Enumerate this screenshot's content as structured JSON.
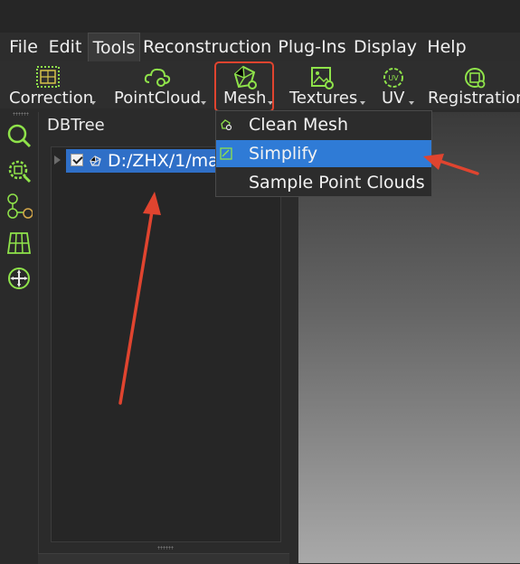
{
  "menubar": {
    "items": [
      "File",
      "Edit",
      "Tools",
      "Reconstruction",
      "Plug-Ins",
      "Display",
      "Help"
    ],
    "active": "Tools"
  },
  "toolbar": {
    "buttons": [
      {
        "label": "Correction",
        "icon": "correction-grid-icon"
      },
      {
        "label": "PointCloud",
        "icon": "pointcloud-gear-icon"
      },
      {
        "label": "Mesh",
        "icon": "mesh-gear-icon"
      },
      {
        "label": "Textures",
        "icon": "textures-gear-icon"
      },
      {
        "label": "UV",
        "icon": "uv-gear-icon"
      },
      {
        "label": "Registration",
        "icon": "registration-gear-icon"
      }
    ]
  },
  "left_tools": [
    "zoom-icon",
    "zoom-fit-icon",
    "axes-icon",
    "grid-plane-icon",
    "navigation-icon"
  ],
  "dbtree": {
    "title": "DBTree",
    "items": [
      {
        "label": "D:/ZHX/1/ma",
        "checked": true
      }
    ]
  },
  "mesh_menu": {
    "items": [
      "Clean Mesh",
      "Simplify",
      "Sample Point Clouds"
    ],
    "selected": "Simplify"
  },
  "colors": {
    "accent_blue": "#2f7bd6",
    "annotation_red": "#e0442f",
    "icon_green": "#8fe34a"
  }
}
